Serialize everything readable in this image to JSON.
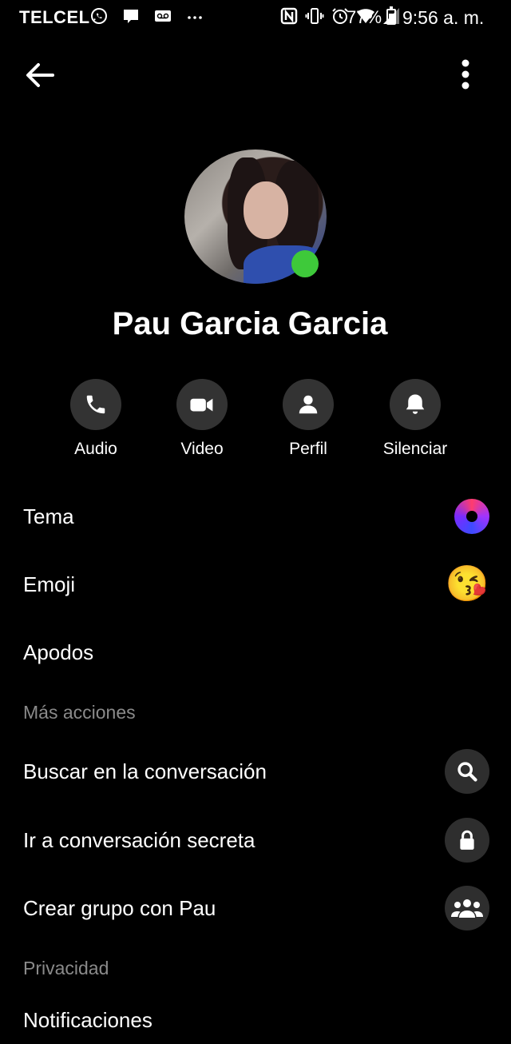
{
  "status_bar": {
    "carrier": "TELCEL",
    "battery": "77%",
    "time": "9:56 a. m.",
    "icons": [
      "whatsapp-icon",
      "message-icon",
      "voicemail-icon",
      "more-dots-icon",
      "nfc-icon",
      "vibrate-icon",
      "alarm-icon",
      "wifi-icon",
      "signal-icon",
      "battery-icon"
    ]
  },
  "header": {
    "back_icon": "arrow-left-icon",
    "more_icon": "more-vertical-icon"
  },
  "profile": {
    "name": "Pau Garcia Garcia",
    "online_color": "#3ec93a"
  },
  "actions": [
    {
      "label": "Audio",
      "icon": "phone-icon"
    },
    {
      "label": "Video",
      "icon": "video-camera-icon"
    },
    {
      "label": "Perfil",
      "icon": "person-icon"
    },
    {
      "label": "Silenciar",
      "icon": "bell-icon"
    }
  ],
  "settings": {
    "theme": "Tema",
    "emoji_label": "Emoji",
    "emoji_value": "😘",
    "nicknames": "Apodos"
  },
  "more_actions": {
    "title": "Más acciones",
    "items": [
      {
        "label": "Buscar en la conversación",
        "icon": "search-icon"
      },
      {
        "label": "Ir a conversación secreta",
        "icon": "lock-icon"
      },
      {
        "label": "Crear grupo con Pau",
        "icon": "group-icon"
      }
    ]
  },
  "privacy": {
    "title": "Privacidad",
    "notifications": "Notificaciones"
  }
}
